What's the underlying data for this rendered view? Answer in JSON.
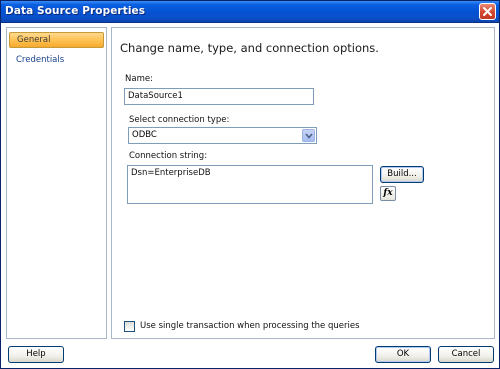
{
  "window": {
    "title": "Data Source Properties"
  },
  "sidebar": {
    "items": [
      {
        "label": "General",
        "selected": true
      },
      {
        "label": "Credentials",
        "selected": false
      }
    ]
  },
  "main": {
    "heading": "Change name, type, and connection options.",
    "name_label": "Name:",
    "name_value": "DataSource1",
    "type_label": "Select connection type:",
    "type_value": "ODBC",
    "conn_label": "Connection string:",
    "conn_value": "Dsn=EnterpriseDB",
    "build_label": "Build...",
    "fx_label": "fx",
    "checkbox_label": "Use single transaction when processing the queries",
    "checkbox_checked": false
  },
  "footer": {
    "help_label": "Help",
    "ok_label": "OK",
    "cancel_label": "Cancel"
  },
  "colors": {
    "titlebar": "#0553d4",
    "selected_nav": "#ffc04f",
    "nav_text": "#15428b"
  }
}
